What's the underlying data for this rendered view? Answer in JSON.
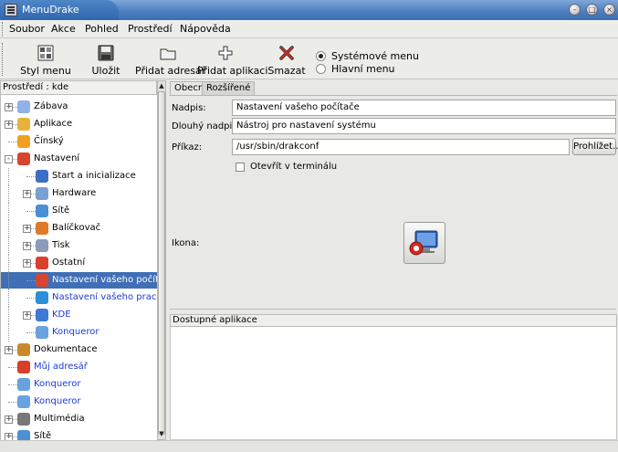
{
  "window": {
    "title": "MenuDrake"
  },
  "menubar": {
    "items": [
      "Soubor",
      "Akce",
      "Pohled",
      "Prostředí",
      "Nápověda"
    ]
  },
  "toolbar": {
    "buttons": [
      {
        "label": "Styl menu",
        "icon": "grid-icon"
      },
      {
        "label": "Uložit",
        "icon": "floppy-icon"
      },
      {
        "label": "Přidat adresář",
        "icon": "folder-icon"
      },
      {
        "label": "Přidat aplikaci",
        "icon": "plus-icon"
      },
      {
        "label": "Smazat",
        "icon": "delete-x-icon"
      }
    ],
    "menu_type": {
      "options": [
        "Systémové menu",
        "Hlavní menu"
      ],
      "selected": "Systémové menu"
    }
  },
  "tree": {
    "header": "Prostředí : kde",
    "items": [
      {
        "label": "Zábava",
        "icon": "palette-icon",
        "level": 0,
        "expander": "+"
      },
      {
        "label": "Aplikace",
        "icon": "apps-icon",
        "level": 0,
        "expander": "+"
      },
      {
        "label": "Čínský",
        "icon": "cn-icon",
        "level": 0,
        "expander": ""
      },
      {
        "label": "Nastavení",
        "icon": "config-icon",
        "level": 0,
        "expander": "-"
      },
      {
        "label": "Start a inicializace",
        "icon": "startup-icon",
        "level": 1,
        "expander": ""
      },
      {
        "label": "Hardware",
        "icon": "hardware-icon",
        "level": 1,
        "expander": "+"
      },
      {
        "label": "Sítě",
        "icon": "network-icon",
        "level": 1,
        "expander": ""
      },
      {
        "label": "Balíčkovač",
        "icon": "package-icon",
        "level": 1,
        "expander": "+"
      },
      {
        "label": "Tisk",
        "icon": "printer-icon",
        "level": 1,
        "expander": "+"
      },
      {
        "label": "Ostatní",
        "icon": "other-icon",
        "level": 1,
        "expander": "+"
      },
      {
        "label": "Nastavení vašeho počítače",
        "icon": "computer-config-icon",
        "level": 1,
        "expander": "",
        "selected": true
      },
      {
        "label": "Nastavení vašeho pracovního prostředí",
        "icon": "desktop-config-icon",
        "level": 1,
        "expander": "",
        "link": true
      },
      {
        "label": "KDE",
        "icon": "kde-icon",
        "level": 1,
        "expander": "+",
        "link": true
      },
      {
        "label": "Konqueror",
        "icon": "konqueror-icon",
        "level": 1,
        "expander": "",
        "link": true
      },
      {
        "label": "Dokumentace",
        "icon": "docs-icon",
        "level": 0,
        "expander": "+"
      },
      {
        "label": "Můj adresář",
        "icon": "home-icon",
        "level": 0,
        "expander": "",
        "link": true
      },
      {
        "label": "Konqueror",
        "icon": "konqueror-icon",
        "level": 0,
        "expander": "",
        "link": true
      },
      {
        "label": "Konqueror",
        "icon": "konqueror-icon",
        "level": 0,
        "expander": "",
        "link": true
      },
      {
        "label": "Multimédia",
        "icon": "multimedia-icon",
        "level": 0,
        "expander": "+"
      },
      {
        "label": "Sítě",
        "icon": "network-icon",
        "level": 0,
        "expander": "+"
      }
    ]
  },
  "tabs": [
    "Obecné",
    "Rozšířené"
  ],
  "form": {
    "nadpis_label": "Nadpis:",
    "nadpis_value": "Nastavení vašeho počítače",
    "dlouhy_label": "Dlouhý nadpis:",
    "dlouhy_value": "Nástroj pro nastavení systému",
    "prikaz_label": "Příkaz:",
    "prikaz_value": "/usr/sbin/drakconf",
    "browse_label": "Prohlížet...",
    "terminal_label": "Otevřít v terminálu",
    "ikona_label": "Ikona:"
  },
  "available": {
    "header": "Dostupné aplikace"
  },
  "colors": {
    "selection": "#3f6fb6",
    "link": "#1d3bd6",
    "title_bar": "#4d7fc0"
  }
}
